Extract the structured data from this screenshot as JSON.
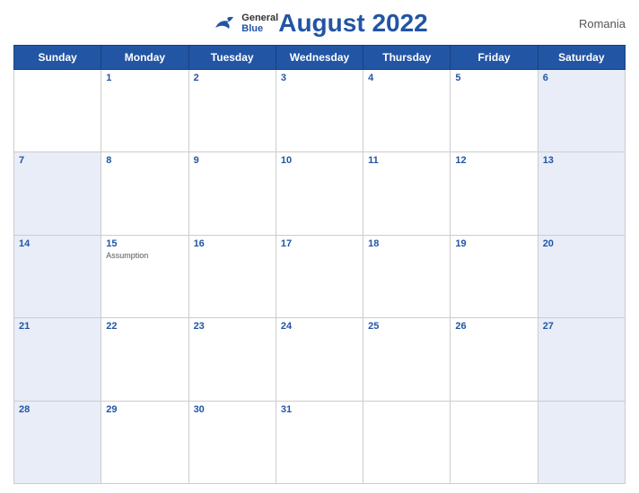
{
  "header": {
    "title": "August 2022",
    "country": "Romania",
    "logo": {
      "general": "General",
      "blue": "Blue"
    }
  },
  "days_of_week": [
    "Sunday",
    "Monday",
    "Tuesday",
    "Wednesday",
    "Thursday",
    "Friday",
    "Saturday"
  ],
  "weeks": [
    [
      {
        "day": "",
        "empty": true,
        "weekend": false
      },
      {
        "day": "1",
        "weekend": false
      },
      {
        "day": "2",
        "weekend": false
      },
      {
        "day": "3",
        "weekend": false
      },
      {
        "day": "4",
        "weekend": false
      },
      {
        "day": "5",
        "weekend": false
      },
      {
        "day": "6",
        "weekend": true
      }
    ],
    [
      {
        "day": "7",
        "weekend": true
      },
      {
        "day": "8",
        "weekend": false
      },
      {
        "day": "9",
        "weekend": false
      },
      {
        "day": "10",
        "weekend": false
      },
      {
        "day": "11",
        "weekend": false
      },
      {
        "day": "12",
        "weekend": false
      },
      {
        "day": "13",
        "weekend": true
      }
    ],
    [
      {
        "day": "14",
        "weekend": true
      },
      {
        "day": "15",
        "weekend": false,
        "holiday": "Assumption"
      },
      {
        "day": "16",
        "weekend": false
      },
      {
        "day": "17",
        "weekend": false
      },
      {
        "day": "18",
        "weekend": false
      },
      {
        "day": "19",
        "weekend": false
      },
      {
        "day": "20",
        "weekend": true
      }
    ],
    [
      {
        "day": "21",
        "weekend": true
      },
      {
        "day": "22",
        "weekend": false
      },
      {
        "day": "23",
        "weekend": false
      },
      {
        "day": "24",
        "weekend": false
      },
      {
        "day": "25",
        "weekend": false
      },
      {
        "day": "26",
        "weekend": false
      },
      {
        "day": "27",
        "weekend": true
      }
    ],
    [
      {
        "day": "28",
        "weekend": true
      },
      {
        "day": "29",
        "weekend": false
      },
      {
        "day": "30",
        "weekend": false
      },
      {
        "day": "31",
        "weekend": false
      },
      {
        "day": "",
        "empty": true,
        "weekend": false
      },
      {
        "day": "",
        "empty": true,
        "weekend": false
      },
      {
        "day": "",
        "empty": true,
        "weekend": true
      }
    ]
  ]
}
